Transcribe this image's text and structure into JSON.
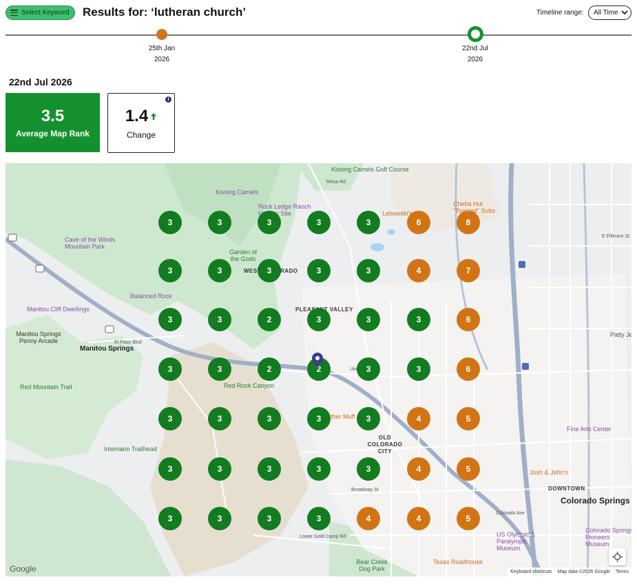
{
  "header": {
    "select_keyword_label": "Select Keyword",
    "title": "Results for: ‘lutheran church’",
    "timeline_range_label": "Timeline range:",
    "timeline_range_value": "All Time"
  },
  "timeline": {
    "points": [
      {
        "day": "25th Jan",
        "year": "2026",
        "color": "#d0761a"
      },
      {
        "day": "22nd Jul",
        "year": "2026",
        "color": "#15912e",
        "selected": true
      }
    ]
  },
  "stats": {
    "date": "22nd Jul 2026",
    "average_rank": "3.5",
    "average_rank_label": "Average Map Rank",
    "change": "1.4",
    "change_direction": "up",
    "change_label": "Change"
  },
  "map": {
    "grid": [
      [
        "3",
        "3",
        "3",
        "3",
        "3",
        "6",
        "8"
      ],
      [
        "3",
        "3",
        "3",
        "3",
        "3",
        "4",
        "7"
      ],
      [
        "3",
        "3",
        "2",
        "3",
        "3",
        "3",
        "6"
      ],
      [
        "3",
        "3",
        "2",
        "2",
        "3",
        "3",
        "6"
      ],
      [
        "3",
        "3",
        "3",
        "3",
        "3",
        "4",
        "5"
      ],
      [
        "3",
        "3",
        "3",
        "3",
        "3",
        "4",
        "5"
      ],
      [
        "3",
        "3",
        "3",
        "3",
        "4",
        "4",
        "5"
      ]
    ],
    "colors": {
      "green": "#137b20",
      "orange": "#d27414"
    },
    "labels": {
      "kissing_camels_golf": "Kissing Camels Golf Course",
      "kissing_camels": "Kissing Camels",
      "rock_ledge": "Rock Ledge Ranch Historic Site",
      "lebowski": "Lebowski's",
      "cheba_hut": "Cheba Hut \"Toasted\" Subs",
      "cave_winds": "Cave of the Winds Mountain Park",
      "garden_gods": "Garden of the Gods",
      "west_colorado": "WEST COLORADO",
      "balanced_rock": "Balanced Rock",
      "manitou_cliff": "Manitou Cliff Dwellings",
      "pleasant_valley": "PLEASANT VALLEY",
      "manitou_arcade": "Manitou Springs Penny Arcade",
      "manitou_city": "Manitou Springs",
      "red_mountain": "Red Mountain Trail",
      "red_rock": "Red Rock Canyon",
      "intemann": "Intemann Trailhead",
      "old_colorado": "OLD COLORADO CITY",
      "fine_arts": "Fine Arts Center",
      "josh_johns": "Josh & John's",
      "downtown": "DOWNTOWN",
      "colorado_springs": "Colorado Springs",
      "us_olympic": "US Olympic & Paralympic Museum",
      "pioneers": "Colorado Springs Pioneers Museum",
      "bear_creek": "Bear Creek Dog Park",
      "texas_roadhouse": "Texas Roadhouse",
      "broadway": "Broadway St",
      "lower_gold_camp": "Lower Gold Camp Rd",
      "el_paso": "El Paso Blvd",
      "colorado_ave": "Colorado Ave",
      "mesa_rd": "Mesa Rd",
      "uintah": "Uintah St",
      "fillmore": "E Fillmore St",
      "patty_jew": "Patty Je",
      "sub_restaurant": "ther Muff"
    },
    "google": "Google",
    "keyboard_shortcuts": "Keyboard shortcuts",
    "map_data": "Map data ©2026 Google",
    "terms": "Terms"
  }
}
